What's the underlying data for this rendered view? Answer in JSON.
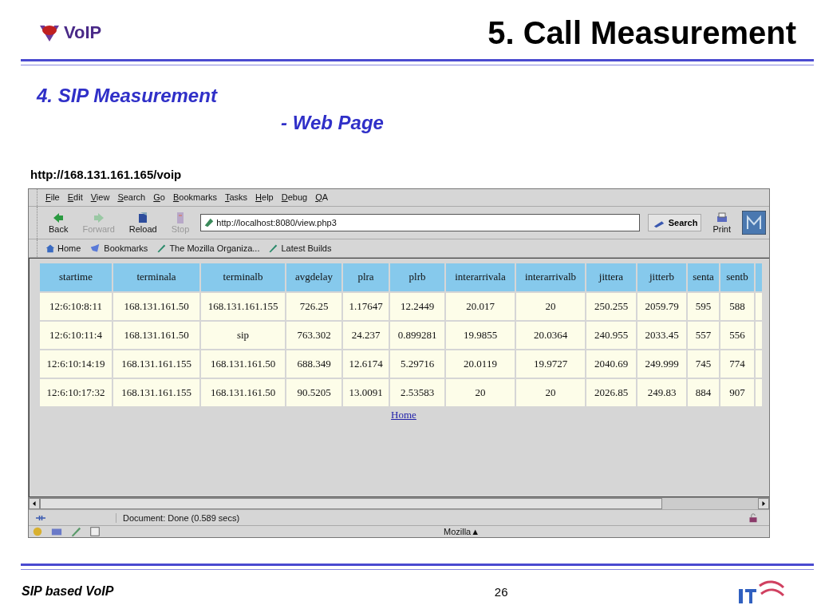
{
  "slide": {
    "logo": "VoIP",
    "title": "5. Call Measurement",
    "subtitle": "4. SIP Measurement",
    "subtitle_2": "- Web Page",
    "url": "http://168.131.161.165/voip"
  },
  "browser": {
    "menu": [
      "File",
      "Edit",
      "View",
      "Search",
      "Go",
      "Bookmarks",
      "Tasks",
      "Help",
      "Debug",
      "QA"
    ],
    "nav_buttons": [
      {
        "label": "Back",
        "kind": "back",
        "disabled": false
      },
      {
        "label": "Forward",
        "kind": "forward",
        "disabled": true
      },
      {
        "label": "Reload",
        "kind": "reload",
        "disabled": false
      },
      {
        "label": "Stop",
        "kind": "stop",
        "disabled": true
      }
    ],
    "address": "http://localhost:8080/view.php3",
    "search_button": "Search",
    "print_button": "Print",
    "bookmarks": [
      {
        "label": "Home",
        "kind": "home"
      },
      {
        "label": "Bookmarks",
        "kind": "bookmarks"
      },
      {
        "label": "The Mozilla Organiza...",
        "kind": "link"
      },
      {
        "label": "Latest Builds",
        "kind": "link"
      }
    ],
    "table": {
      "columns": [
        "startime",
        "terminala",
        "terminalb",
        "avgdelay",
        "plra",
        "plrb",
        "interarrivala",
        "interarrivalb",
        "jittera",
        "jitterb",
        "senta",
        "sentb"
      ],
      "rows": [
        [
          "12:6:10:8:11",
          "168.131.161.50",
          "168.131.161.155",
          "726.25",
          "1.17647",
          "12.2449",
          "20.017",
          "20",
          "250.255",
          "2059.79",
          "595",
          "588"
        ],
        [
          "12:6:10:11:4",
          "168.131.161.50",
          "sip",
          "763.302",
          "24.237",
          "0.899281",
          "19.9855",
          "20.0364",
          "240.955",
          "2033.45",
          "557",
          "556"
        ],
        [
          "12:6:10:14:19",
          "168.131.161.155",
          "168.131.161.50",
          "688.349",
          "12.6174",
          "5.29716",
          "20.0119",
          "19.9727",
          "2040.69",
          "249.999",
          "745",
          "774"
        ],
        [
          "12:6:10:17:32",
          "168.131.161.155",
          "168.131.161.50",
          "90.5205",
          "13.0091",
          "2.53583",
          "20",
          "20",
          "2026.85",
          "249.83",
          "884",
          "907"
        ]
      ]
    },
    "home_link": "Home",
    "status": "Document: Done (0.589 secs)",
    "component_bar": "Mozilla▲"
  },
  "footer": {
    "left": "SIP based VoIP",
    "page": "26"
  }
}
